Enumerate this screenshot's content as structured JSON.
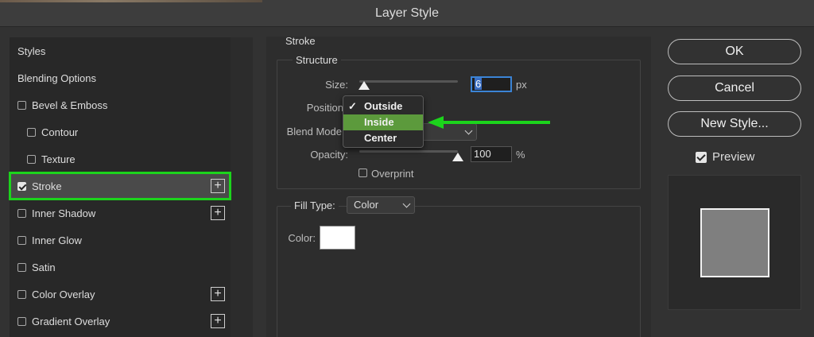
{
  "window": {
    "title": "Layer Style"
  },
  "styles_list": {
    "items": [
      {
        "label": "Styles",
        "has_checkbox": false,
        "checked": false,
        "has_plus": false,
        "indent": 0
      },
      {
        "label": "Blending Options",
        "has_checkbox": false,
        "checked": false,
        "has_plus": false,
        "indent": 0
      },
      {
        "label": "Bevel & Emboss",
        "has_checkbox": true,
        "checked": false,
        "has_plus": false,
        "indent": 0
      },
      {
        "label": "Contour",
        "has_checkbox": true,
        "checked": false,
        "has_plus": false,
        "indent": 1
      },
      {
        "label": "Texture",
        "has_checkbox": true,
        "checked": false,
        "has_plus": false,
        "indent": 1
      },
      {
        "label": "Stroke",
        "has_checkbox": true,
        "checked": true,
        "has_plus": true,
        "indent": 0,
        "selected": true
      },
      {
        "label": "Inner Shadow",
        "has_checkbox": true,
        "checked": false,
        "has_plus": true,
        "indent": 0
      },
      {
        "label": "Inner Glow",
        "has_checkbox": true,
        "checked": false,
        "has_plus": false,
        "indent": 0
      },
      {
        "label": "Satin",
        "has_checkbox": true,
        "checked": false,
        "has_plus": false,
        "indent": 0
      },
      {
        "label": "Color Overlay",
        "has_checkbox": true,
        "checked": false,
        "has_plus": true,
        "indent": 0
      },
      {
        "label": "Gradient Overlay",
        "has_checkbox": true,
        "checked": false,
        "has_plus": true,
        "indent": 0
      }
    ],
    "plus_glyph": "+"
  },
  "stroke": {
    "section_title": "Stroke",
    "structure_title": "Structure",
    "size": {
      "label": "Size:",
      "value": "6",
      "unit": "px"
    },
    "position": {
      "label": "Position"
    },
    "position_menu": {
      "options": [
        "Outside",
        "Inside",
        "Center"
      ],
      "checked": "Outside",
      "highlighted": "Inside",
      "check_glyph": "✓"
    },
    "blend_mode": {
      "label": "Blend Mode"
    },
    "opacity": {
      "label": "Opacity:",
      "value": "100",
      "unit": "%"
    },
    "overprint": {
      "label": "Overprint",
      "checked": false
    },
    "fill_type": {
      "label": "Fill Type:",
      "value": "Color"
    },
    "color": {
      "label": "Color:",
      "swatch": "#ffffff"
    }
  },
  "buttons": {
    "ok": "OK",
    "cancel": "Cancel",
    "new_style": "New Style..."
  },
  "preview": {
    "label": "Preview",
    "checked": true
  },
  "colors": {
    "highlight_green": "#1cd41c",
    "menu_highlight": "#5c9a3c",
    "input_focus": "#3b84d6"
  },
  "icons": {
    "checkbox": "checkbox-icon",
    "plus": "plus-icon",
    "chevron": "chevron-down-icon",
    "slider_thumb": "slider-thumb-icon",
    "annotation_arrow": "arrow-left-icon"
  }
}
